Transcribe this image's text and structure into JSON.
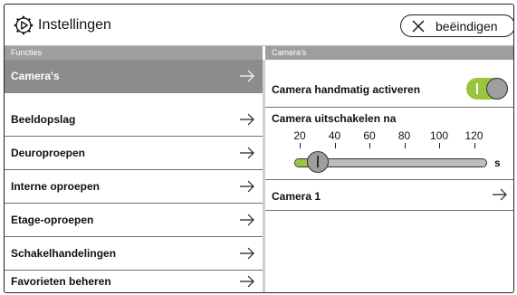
{
  "header": {
    "title": "Instellingen",
    "end_button_label": "beëindigen",
    "settings_icon": "gear-icon",
    "end_icon": "close-icon"
  },
  "left_panel": {
    "section_title": "Functies",
    "items": [
      {
        "label": "Camera's",
        "active": true
      },
      {
        "label": "Beeldopslag",
        "active": false
      },
      {
        "label": "Deuroproepen",
        "active": false
      },
      {
        "label": "Interne oproepen",
        "active": false
      },
      {
        "label": "Etage-oproepen",
        "active": false
      },
      {
        "label": "Schakelhandelingen",
        "active": false
      },
      {
        "label": "Favorieten beheren",
        "active": false
      }
    ]
  },
  "right_panel": {
    "section_title": "Camera's",
    "manual_activation": {
      "label": "Camera handmatig activeren",
      "enabled": true
    },
    "auto_off": {
      "label": "Camera uitschakelen na",
      "ticks": [
        "20",
        "40",
        "60",
        "80",
        "100",
        "120"
      ],
      "min": 10,
      "max": 130,
      "value": 20,
      "unit": "s"
    },
    "camera_item": {
      "label": "Camera 1"
    }
  },
  "colors": {
    "accent_green": "#9bc53d",
    "section_grey": "#9e9e9e",
    "active_grey": "#8c8c8c"
  }
}
